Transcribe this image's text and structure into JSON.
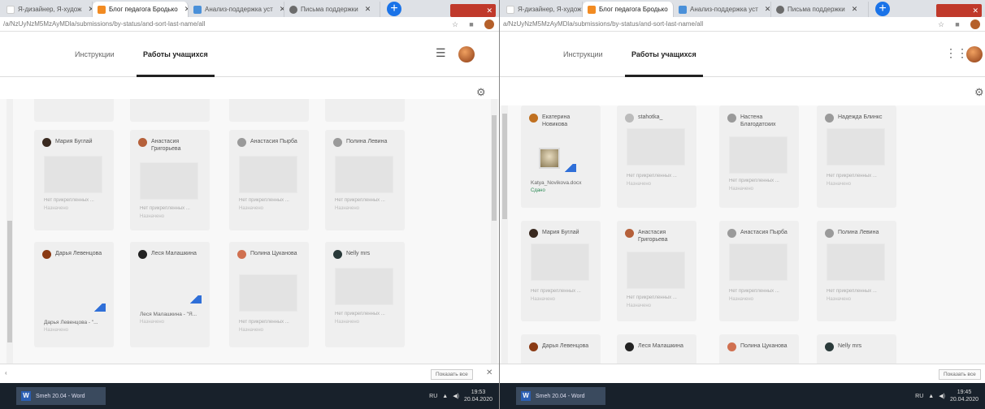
{
  "left": {
    "tabs": [
      {
        "title": "Я-дизайнер, Я-худож",
        "color": "#ffffff"
      },
      {
        "title": "Блог педагога Бродько",
        "color": "#f28b22"
      },
      {
        "title": "Анализ-поддержка уст",
        "color": "#4a90d9"
      },
      {
        "title": "Письма поддержки",
        "color": "#6b6b6b"
      }
    ],
    "url": "/a/NzUyNzM5MzAyMDla/submissions/by-status/and-sort-last-name/all",
    "nav": [
      "Инструкции",
      "Работы учащихся"
    ],
    "cards": [
      {
        "name": "Мария Буглай",
        "av": "#3a2a20",
        "status": "Нет прикрепленных ...",
        "sub": "Назначено"
      },
      {
        "name": "Анастасия Григорьева",
        "av": "#b5603a",
        "status": "Нет прикрепленных ...",
        "sub": "Назначено"
      },
      {
        "name": "Анастасия Пырба",
        "av": "#9a9a9a",
        "status": "Нет прикрепленных ...",
        "sub": "Назначено"
      },
      {
        "name": "Полина Левина",
        "av": "#9a9a9a",
        "status": "Нет прикрепленных ...",
        "sub": "Назначено"
      },
      {
        "name": "Дарья Левенцова",
        "av": "#8a3a14",
        "file": "Дарья Левенцова - \"...",
        "sub": "Назначено"
      },
      {
        "name": "Леся Малашкина",
        "av": "#222222",
        "file": "Леся Малашкина - \"Я...",
        "sub": "Назначено"
      },
      {
        "name": "Полина Цуканова",
        "av": "#d07050",
        "status": "Нет прикрепленных ...",
        "sub": "Назначено"
      },
      {
        "name": "Nelly mrs",
        "av": "#2a3a3a",
        "status": "Нет прикрепленных ...",
        "sub": "Назначено"
      }
    ],
    "show_all": "Показать все",
    "taskbar": {
      "word": "Smeh 20.04 - Word",
      "lang": "RU",
      "time": "19:53",
      "date": "20.04.2020"
    }
  },
  "right": {
    "tabs": [
      {
        "title": "Я-дизайнер, Я-худож",
        "color": "#ffffff"
      },
      {
        "title": "Блог педагога Бродько",
        "color": "#f28b22"
      },
      {
        "title": "Анализ-поддержка уст",
        "color": "#4a90d9"
      },
      {
        "title": "Письма поддержки",
        "color": "#6b6b6b"
      }
    ],
    "url": "a/NzUyNzM5MzAyMDla/submissions/by-status/and-sort-last-name/all",
    "nav": [
      "Инструкции",
      "Работы учащихся"
    ],
    "cards_top": [
      {
        "name": "Екатерина Новикова",
        "av": "#c07020",
        "file": "Katya_Novikova.docx",
        "green": "Сдано"
      },
      {
        "name": "stahotka_",
        "av": "#bbbbbb",
        "status": "Нет прикрепленных ...",
        "sub": "Назначено"
      },
      {
        "name": "Настена Благодатских",
        "av": "#9a9a9a",
        "status": "Нет прикрепленных ...",
        "sub": "Назначено"
      },
      {
        "name": "Надежда Блинкс",
        "av": "#9a9a9a",
        "status": "Нет прикрепленных ...",
        "sub": "Назначено"
      }
    ],
    "cards_mid": [
      {
        "name": "Мария Буглай",
        "av": "#3a2a20",
        "status": "Нет прикрепленных ...",
        "sub": "Назначено"
      },
      {
        "name": "Анастасия Григорьева",
        "av": "#b5603a",
        "status": "Нет прикрепленных ...",
        "sub": "Назначено"
      },
      {
        "name": "Анастасия Пырба",
        "av": "#9a9a9a",
        "status": "Нет прикрепленных ...",
        "sub": "Назначено"
      },
      {
        "name": "Полина Левина",
        "av": "#9a9a9a",
        "status": "Нет прикрепленных ...",
        "sub": "Назначено"
      }
    ],
    "cards_bot": [
      {
        "name": "Дарья Левенцова",
        "av": "#8a3a14"
      },
      {
        "name": "Леся Малашкина",
        "av": "#222222"
      },
      {
        "name": "Полина Цуканова",
        "av": "#d07050"
      },
      {
        "name": "Nelly mrs",
        "av": "#2a3a3a"
      }
    ],
    "show_all": "Показать все",
    "taskbar": {
      "word": "Smeh 20.04 - Word",
      "lang": "RU",
      "time": "19:45",
      "date": "20.04.2020"
    }
  }
}
